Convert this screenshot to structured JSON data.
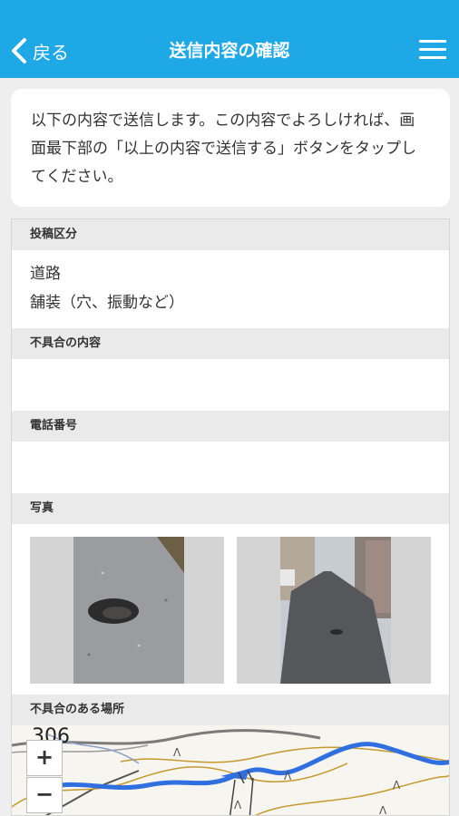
{
  "header": {
    "back_label": "戻る",
    "title": "送信内容の確認"
  },
  "notice": {
    "text": "以下の内容で送信します。この内容でよろしければ、画面最下部の「以上の内容で送信する」ボタンをタップしてください。"
  },
  "sections": {
    "category": {
      "label": "投稿区分",
      "lines": [
        "道路",
        "舗装（穴、振動など）"
      ]
    },
    "detail": {
      "label": "不具合の内容",
      "value": ""
    },
    "phone": {
      "label": "電話番号",
      "value": ""
    },
    "photos": {
      "label": "写真"
    },
    "location": {
      "label": "不具合のある場所",
      "route_number": "306",
      "zoom_in": "+",
      "zoom_out": "−"
    }
  },
  "colors": {
    "header": "#1ea8e6",
    "river": "#2f6fe0"
  }
}
